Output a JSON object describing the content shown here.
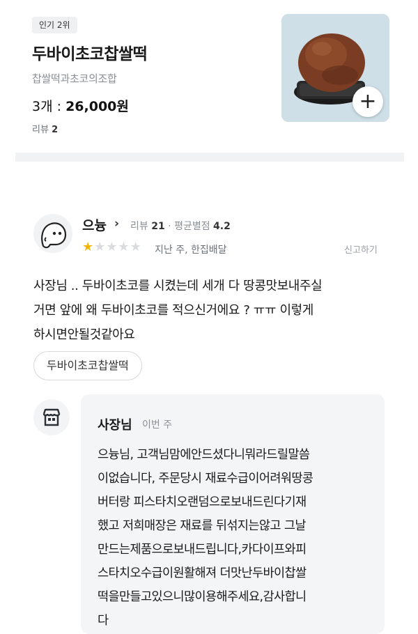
{
  "menu": {
    "badge": "인기 2위",
    "name": "두바이초코찹쌀떡",
    "description": "찹쌀떡과초코의조합",
    "quantity": "3개 : ",
    "price": "26,000원",
    "review_label": "리뷰 ",
    "review_count": "2",
    "add_icon": "plus-icon",
    "add_symbol": "+"
  },
  "review": {
    "reviewer_name": "으늉",
    "chevron": "›",
    "meta_review_label": "리뷰 ",
    "meta_review_count": "21",
    "meta_separator": " · ",
    "meta_rating_label": "평균별점 ",
    "meta_rating_value": "4.2",
    "rating": 1,
    "max_rating": 5,
    "time": "지난 주, 한집배달",
    "report_label": "신고하기",
    "text_lines": [
      "사장님 .. 두바이초코를 시켰는데 세개 다 땅콩맛보내주실",
      "거면 앞에 왜 두바이초코를 적으신거에요 ? ㅠㅠ 이렇게",
      "하시면안될것같아요"
    ],
    "menu_tag": "두바이초코찹쌀떡"
  },
  "reply": {
    "owner_name": "사장님",
    "time": "이번 주",
    "text_lines": [
      "으늉님, 고객님맘에안드셨다니뭐라드릴말씀",
      "이없습니다, 주문당시 재료수급이어려워땅콩",
      "버터랑 피스타치오랜덤으로보내드린다기재",
      "했고 저희매장은 재료를 뒤섞지는않고 그날",
      "만드는제품으로보내드립니다,카다이프와피",
      "스타치오수급이원활해져 더맛난두바이찹쌀",
      "떡을만들고있으니많이용해주세요,감사합니",
      "다"
    ]
  },
  "colors": {
    "star_on": "#f2b705",
    "star_off": "#d9dbde",
    "muted_text": "#8a8f96",
    "reply_bg": "#f4f5f7"
  }
}
